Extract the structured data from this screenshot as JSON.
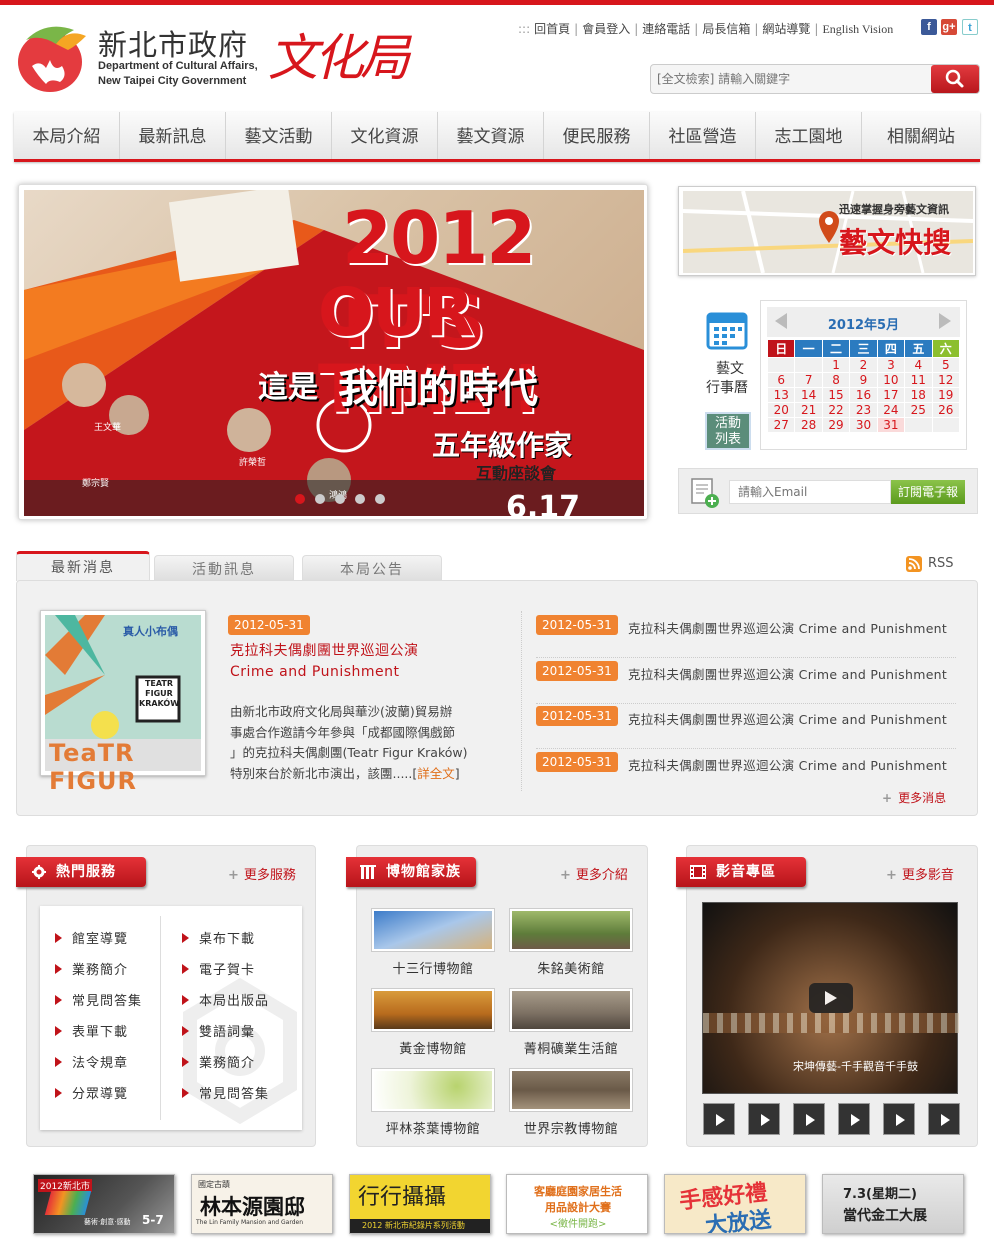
{
  "header": {
    "org_zh": "新北市政府",
    "org_en_line1": "Department of Cultural Affairs,",
    "org_en_line2": "New Taipei City Government",
    "bureau": "文化局",
    "top_links": [
      "回首頁",
      "會員登入",
      "連絡電話",
      "局長信箱",
      "網站導覽",
      "English Vision"
    ],
    "search_placeholder": "[全文檢索] 請輸入關鍵字"
  },
  "nav": [
    "本局介紹",
    "最新訊息",
    "藝文活動",
    "文化資源",
    "藝文資源",
    "便民服務",
    "社區營造",
    "志工園地",
    "相關網站"
  ],
  "banner": {
    "headline1": "2012 IT'S",
    "headline2": "OUR TIME !",
    "sub1": "這是",
    "sub2": "我們的時代",
    "sub3": "五年級作家",
    "sub4": "互動座談會",
    "names": [
      "王文華",
      "許榮哲",
      "鄭宗賢",
      "鴻鴻"
    ],
    "date": "6.17"
  },
  "quick": {
    "map_caption": "迅速掌握身旁藝文資訊",
    "title": "藝文快搜"
  },
  "calendar": {
    "icon_label1": "藝文",
    "icon_label2": "行事曆",
    "activities_btn1": "活動",
    "activities_btn2": "列表",
    "month_title": "2012年5月",
    "weekdays": [
      "日",
      "一",
      "二",
      "三",
      "四",
      "五",
      "六"
    ],
    "weeks": [
      [
        "",
        "",
        "1",
        "2",
        "3",
        "4",
        "5"
      ],
      [
        "6",
        "7",
        "8",
        "9",
        "10",
        "11",
        "12"
      ],
      [
        "13",
        "14",
        "15",
        "16",
        "17",
        "18",
        "19"
      ],
      [
        "20",
        "21",
        "22",
        "23",
        "24",
        "25",
        "26"
      ],
      [
        "27",
        "28",
        "29",
        "30",
        "31",
        "",
        ""
      ]
    ],
    "today": "31"
  },
  "epaper": {
    "placeholder": "請輸入Email",
    "button": "訂閱電子報"
  },
  "news": {
    "tabs": [
      "最新消息",
      "活動訊息",
      "本局公告"
    ],
    "rss": "RSS",
    "featured_date": "2012-05-31",
    "featured_title1": "克拉科夫偶劇團世界巡迴公演",
    "featured_title2": "Crime and Punishment",
    "featured_body": [
      "由新北市政府文化局與華沙(波蘭)貿易辦",
      "事處合作邀請今年參與「成都國際偶戲節",
      "」的克拉科夫偶劇團(Teatr Figur Kraków)",
      "特別來台於新北市演出，該團....."
    ],
    "read_more": "詳全文",
    "image_text1": "真人小布偶",
    "image_text2": "TEATR FIGUR KRAKÓW",
    "image_text3": "TeaTR FIGUR",
    "items": [
      {
        "date": "2012-05-31",
        "title": "克拉科夫偶劇團世界巡迴公演 Crime and Punishment"
      },
      {
        "date": "2012-05-31",
        "title": "克拉科夫偶劇團世界巡迴公演 Crime and Punishment"
      },
      {
        "date": "2012-05-31",
        "title": "克拉科夫偶劇團世界巡迴公演 Crime and Punishment"
      },
      {
        "date": "2012-05-31",
        "title": "克拉科夫偶劇團世界巡迴公演 Crime and Punishment"
      }
    ],
    "more": "更多消息"
  },
  "services": {
    "title": "熱門服務",
    "more": "更多服務",
    "left": [
      "館室導覽",
      "業務簡介",
      "常見問答集",
      "表單下載",
      "法令規章",
      "分眾導覽"
    ],
    "right": [
      "桌布下載",
      "電子賀卡",
      "本局出版品",
      "雙語詞彙",
      "業務簡介",
      "常見問答集"
    ]
  },
  "museums": {
    "title": "博物館家族",
    "more": "更多介紹",
    "items": [
      "十三行博物館",
      "朱銘美術館",
      "黃金博物館",
      "菁桐礦業生活館",
      "坪林茶葉博物館",
      "世界宗教博物館"
    ]
  },
  "video": {
    "title": "影音專區",
    "more": "更多影音",
    "caption": "宋坤傳藝-千手觀音千手鼓"
  },
  "ads": [
    {
      "line1": "2012新北市",
      "line2": "5-7",
      "line3": "藝術‧創意‧感動"
    },
    {
      "line1": "國定古蹟",
      "line2": "林本源園邸",
      "line3": "The Lin Family Mansion and Garden"
    },
    {
      "line1": "行行攝攝",
      "line2": "2012 新北市紀錄片系列活動"
    },
    {
      "line1": "客廳庭園家居生活",
      "line2": "用品設計大賽",
      "line3": "<徵件開跑>"
    },
    {
      "line1": "手感好禮",
      "line2": "大放送"
    },
    {
      "line1": "7.3(星期二)",
      "line2": "當代金工大展"
    }
  ]
}
